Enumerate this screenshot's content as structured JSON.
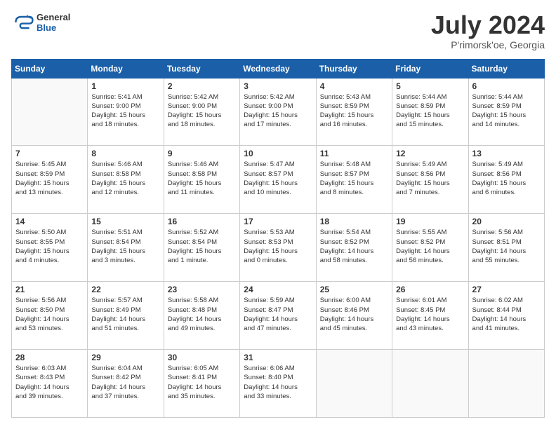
{
  "header": {
    "logo": {
      "general": "General",
      "blue": "Blue"
    },
    "title": "July 2024",
    "location": "P'rimorsk'oe, Georgia"
  },
  "days_of_week": [
    "Sunday",
    "Monday",
    "Tuesday",
    "Wednesday",
    "Thursday",
    "Friday",
    "Saturday"
  ],
  "weeks": [
    [
      {
        "day": "",
        "info": ""
      },
      {
        "day": "1",
        "info": "Sunrise: 5:41 AM\nSunset: 9:00 PM\nDaylight: 15 hours\nand 18 minutes."
      },
      {
        "day": "2",
        "info": "Sunrise: 5:42 AM\nSunset: 9:00 PM\nDaylight: 15 hours\nand 18 minutes."
      },
      {
        "day": "3",
        "info": "Sunrise: 5:42 AM\nSunset: 9:00 PM\nDaylight: 15 hours\nand 17 minutes."
      },
      {
        "day": "4",
        "info": "Sunrise: 5:43 AM\nSunset: 8:59 PM\nDaylight: 15 hours\nand 16 minutes."
      },
      {
        "day": "5",
        "info": "Sunrise: 5:44 AM\nSunset: 8:59 PM\nDaylight: 15 hours\nand 15 minutes."
      },
      {
        "day": "6",
        "info": "Sunrise: 5:44 AM\nSunset: 8:59 PM\nDaylight: 15 hours\nand 14 minutes."
      }
    ],
    [
      {
        "day": "7",
        "info": "Sunrise: 5:45 AM\nSunset: 8:59 PM\nDaylight: 15 hours\nand 13 minutes."
      },
      {
        "day": "8",
        "info": "Sunrise: 5:46 AM\nSunset: 8:58 PM\nDaylight: 15 hours\nand 12 minutes."
      },
      {
        "day": "9",
        "info": "Sunrise: 5:46 AM\nSunset: 8:58 PM\nDaylight: 15 hours\nand 11 minutes."
      },
      {
        "day": "10",
        "info": "Sunrise: 5:47 AM\nSunset: 8:57 PM\nDaylight: 15 hours\nand 10 minutes."
      },
      {
        "day": "11",
        "info": "Sunrise: 5:48 AM\nSunset: 8:57 PM\nDaylight: 15 hours\nand 8 minutes."
      },
      {
        "day": "12",
        "info": "Sunrise: 5:49 AM\nSunset: 8:56 PM\nDaylight: 15 hours\nand 7 minutes."
      },
      {
        "day": "13",
        "info": "Sunrise: 5:49 AM\nSunset: 8:56 PM\nDaylight: 15 hours\nand 6 minutes."
      }
    ],
    [
      {
        "day": "14",
        "info": "Sunrise: 5:50 AM\nSunset: 8:55 PM\nDaylight: 15 hours\nand 4 minutes."
      },
      {
        "day": "15",
        "info": "Sunrise: 5:51 AM\nSunset: 8:54 PM\nDaylight: 15 hours\nand 3 minutes."
      },
      {
        "day": "16",
        "info": "Sunrise: 5:52 AM\nSunset: 8:54 PM\nDaylight: 15 hours\nand 1 minute."
      },
      {
        "day": "17",
        "info": "Sunrise: 5:53 AM\nSunset: 8:53 PM\nDaylight: 15 hours\nand 0 minutes."
      },
      {
        "day": "18",
        "info": "Sunrise: 5:54 AM\nSunset: 8:52 PM\nDaylight: 14 hours\nand 58 minutes."
      },
      {
        "day": "19",
        "info": "Sunrise: 5:55 AM\nSunset: 8:52 PM\nDaylight: 14 hours\nand 56 minutes."
      },
      {
        "day": "20",
        "info": "Sunrise: 5:56 AM\nSunset: 8:51 PM\nDaylight: 14 hours\nand 55 minutes."
      }
    ],
    [
      {
        "day": "21",
        "info": "Sunrise: 5:56 AM\nSunset: 8:50 PM\nDaylight: 14 hours\nand 53 minutes."
      },
      {
        "day": "22",
        "info": "Sunrise: 5:57 AM\nSunset: 8:49 PM\nDaylight: 14 hours\nand 51 minutes."
      },
      {
        "day": "23",
        "info": "Sunrise: 5:58 AM\nSunset: 8:48 PM\nDaylight: 14 hours\nand 49 minutes."
      },
      {
        "day": "24",
        "info": "Sunrise: 5:59 AM\nSunset: 8:47 PM\nDaylight: 14 hours\nand 47 minutes."
      },
      {
        "day": "25",
        "info": "Sunrise: 6:00 AM\nSunset: 8:46 PM\nDaylight: 14 hours\nand 45 minutes."
      },
      {
        "day": "26",
        "info": "Sunrise: 6:01 AM\nSunset: 8:45 PM\nDaylight: 14 hours\nand 43 minutes."
      },
      {
        "day": "27",
        "info": "Sunrise: 6:02 AM\nSunset: 8:44 PM\nDaylight: 14 hours\nand 41 minutes."
      }
    ],
    [
      {
        "day": "28",
        "info": "Sunrise: 6:03 AM\nSunset: 8:43 PM\nDaylight: 14 hours\nand 39 minutes."
      },
      {
        "day": "29",
        "info": "Sunrise: 6:04 AM\nSunset: 8:42 PM\nDaylight: 14 hours\nand 37 minutes."
      },
      {
        "day": "30",
        "info": "Sunrise: 6:05 AM\nSunset: 8:41 PM\nDaylight: 14 hours\nand 35 minutes."
      },
      {
        "day": "31",
        "info": "Sunrise: 6:06 AM\nSunset: 8:40 PM\nDaylight: 14 hours\nand 33 minutes."
      },
      {
        "day": "",
        "info": ""
      },
      {
        "day": "",
        "info": ""
      },
      {
        "day": "",
        "info": ""
      }
    ]
  ]
}
